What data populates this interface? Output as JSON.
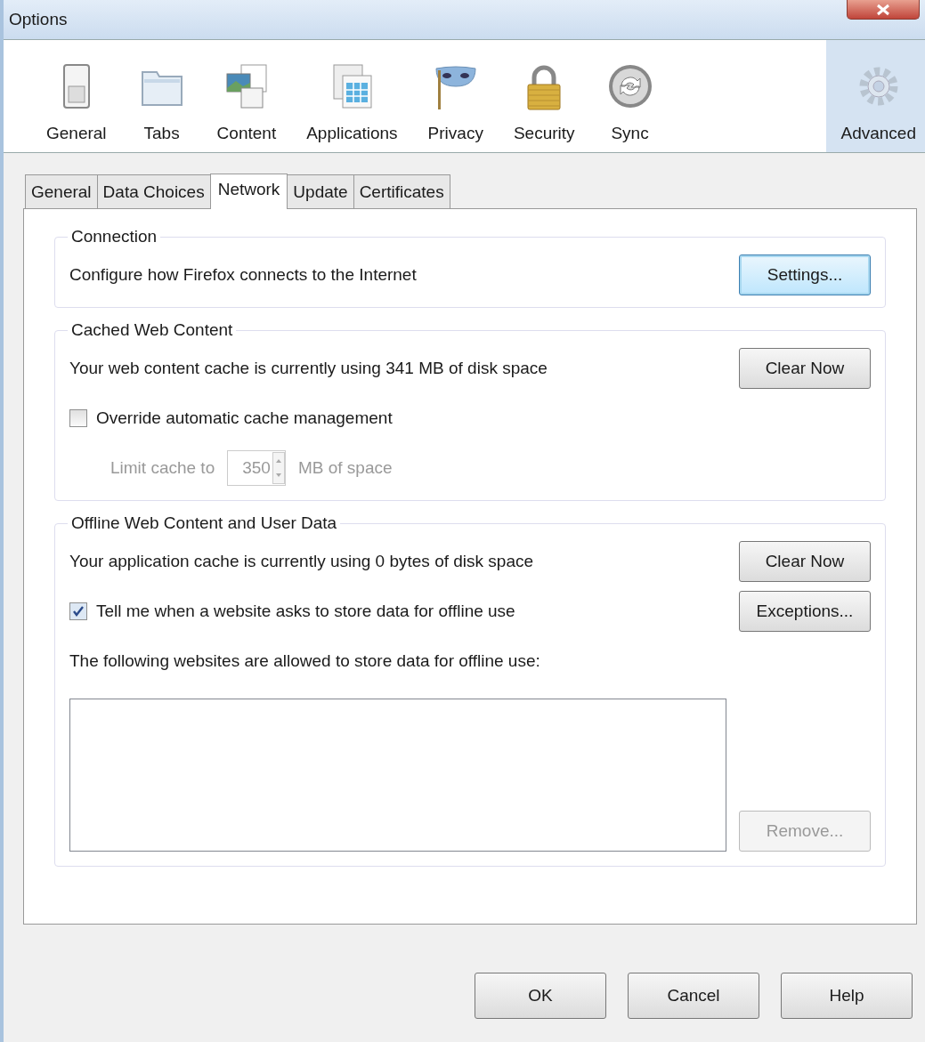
{
  "window": {
    "title": "Options"
  },
  "toolbar": [
    {
      "label": "General",
      "selected": false
    },
    {
      "label": "Tabs",
      "selected": false
    },
    {
      "label": "Content",
      "selected": false
    },
    {
      "label": "Applications",
      "selected": false
    },
    {
      "label": "Privacy",
      "selected": false
    },
    {
      "label": "Security",
      "selected": false
    },
    {
      "label": "Sync",
      "selected": false
    },
    {
      "label": "Advanced",
      "selected": true
    }
  ],
  "subtabs": [
    {
      "label": "General",
      "selected": false
    },
    {
      "label": "Data Choices",
      "selected": false
    },
    {
      "label": "Network",
      "selected": true
    },
    {
      "label": "Update",
      "selected": false
    },
    {
      "label": "Certificates",
      "selected": false
    }
  ],
  "groups": [
    {
      "title": "Connection",
      "rows": [
        {
          "kind": "info",
          "text": "Configure how Firefox connects to the Internet",
          "button": {
            "label": "Settings...",
            "focused": true,
            "disabled": false
          }
        }
      ]
    },
    {
      "title": "Cached Web Content",
      "rows": [
        {
          "kind": "info",
          "text": "Your web content cache is currently using 341 MB of disk space",
          "button": {
            "label": "Clear Now",
            "focused": false,
            "disabled": false
          }
        },
        {
          "kind": "checkbox",
          "label": "Override automatic cache management",
          "checked": false
        },
        {
          "kind": "spinner",
          "label": "Limit cache to",
          "value": "350",
          "unit": "MB of space",
          "disabled": true
        }
      ]
    },
    {
      "title": "Offline Web Content and User Data",
      "rows": [
        {
          "kind": "info",
          "text": "Your application cache is currently using 0 bytes of disk space",
          "button": {
            "label": "Clear Now",
            "focused": false,
            "disabled": false
          }
        },
        {
          "kind": "checkbox",
          "label": "Tell me when a website asks to store data for offline use",
          "checked": true,
          "button": {
            "label": "Exceptions...",
            "focused": false,
            "disabled": false
          }
        },
        {
          "kind": "label",
          "text": "The following websites are allowed to store data for offline use:"
        },
        {
          "kind": "listbox",
          "button": {
            "label": "Remove...",
            "focused": false,
            "disabled": true
          }
        }
      ]
    }
  ],
  "footer": [
    "OK",
    "Cancel",
    "Help"
  ]
}
